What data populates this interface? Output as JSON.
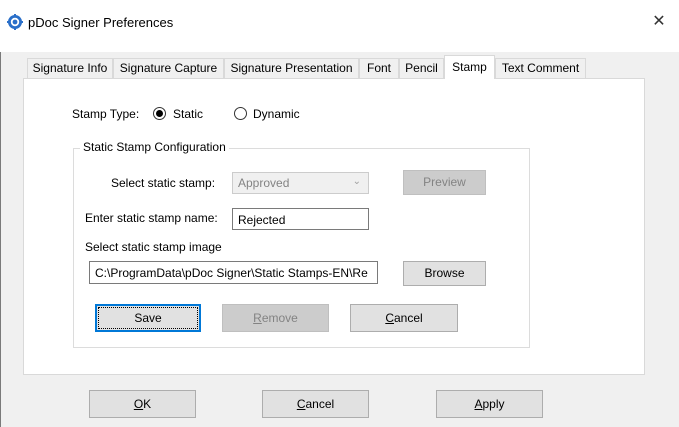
{
  "window": {
    "title": "pDoc Signer Preferences",
    "close_glyph": "✕"
  },
  "tabs": [
    {
      "label": "Signature Info"
    },
    {
      "label": "Signature Capture"
    },
    {
      "label": "Signature Presentation"
    },
    {
      "label": "Font"
    },
    {
      "label": "Pencil"
    },
    {
      "label": "Stamp",
      "active": true
    },
    {
      "label": "Text Comment"
    }
  ],
  "stamp": {
    "type_label": "Stamp Type:",
    "static_label": "Static",
    "dynamic_label": "Dynamic",
    "selected_type": "Static",
    "group_title": "Static Stamp Configuration",
    "select_label": "Select  static stamp:",
    "selected_stamp": "Approved",
    "preview_button": "Preview",
    "name_label": "Enter static stamp name:",
    "name_value": "Rejected",
    "image_label": "Select static stamp image",
    "image_path": "C:\\ProgramData\\pDoc Signer\\Static Stamps-EN\\Re",
    "browse_button": "Browse",
    "save_button": "Save",
    "remove_first": "R",
    "remove_rest": "emove",
    "cancel_first": "C",
    "cancel_rest": "ancel"
  },
  "footer": {
    "ok_first": "O",
    "ok_rest": "K",
    "cancel_first": "C",
    "cancel_rest": "ancel",
    "apply_first": "A",
    "apply_rest": "pply"
  },
  "icons": {
    "app": "gear-icon",
    "combo_arrow": "chevron-down-icon",
    "close": "close-icon"
  },
  "colors": {
    "accent": "#0078d7",
    "disabled_text": "#838383",
    "tab_page": "#ffffff",
    "dialog_bg": "#f0f0f0"
  }
}
